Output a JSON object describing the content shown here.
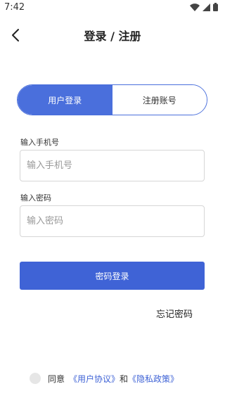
{
  "status_bar": {
    "time": "7:42",
    "icons": [
      "wifi-icon",
      "signal-icon",
      "battery-icon"
    ]
  },
  "nav": {
    "back_icon": "back-arrow-icon",
    "title": "登录 / 注册"
  },
  "tabs": [
    {
      "label": "用户登录",
      "active": true
    },
    {
      "label": "注册账号",
      "active": false
    }
  ],
  "form": {
    "phone_label": "输入手机号",
    "phone_placeholder": "输入手机号",
    "phone_value": "",
    "password_label": "输入密码",
    "password_placeholder": "输入密码",
    "password_value": ""
  },
  "login_button": "密码登录",
  "forgot_password": "忘记密码",
  "agreement": {
    "checked": false,
    "prefix": "同意",
    "user_agreement": "《用户协议》",
    "and": "和",
    "privacy_policy": "《隐私政策》"
  },
  "colors": {
    "accent": "#4a6fdc",
    "button": "#3f63d6"
  }
}
